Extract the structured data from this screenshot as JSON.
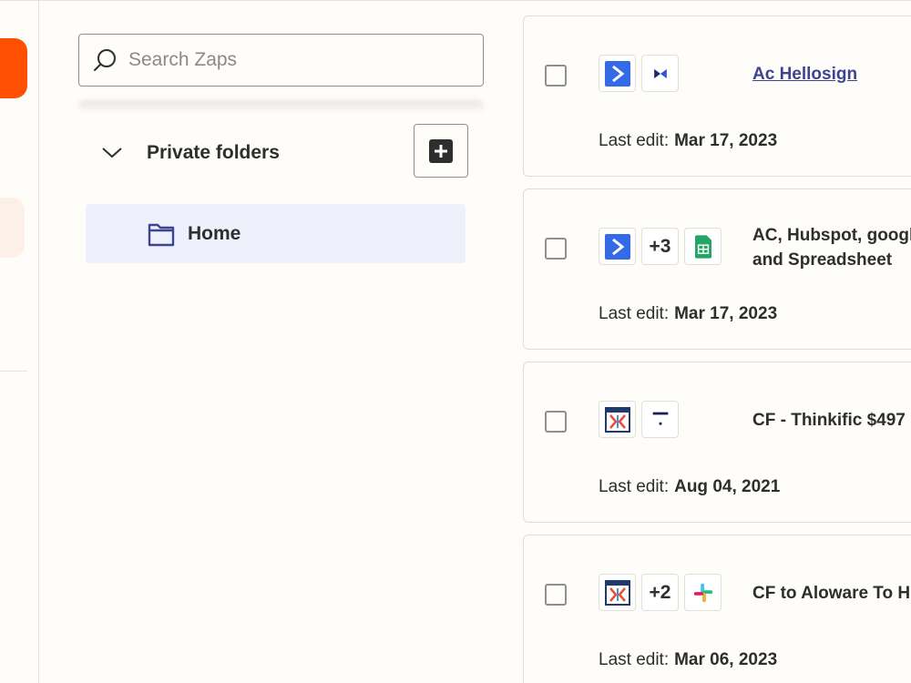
{
  "search": {
    "placeholder": "Search Zaps"
  },
  "folders": {
    "header": "Private folders",
    "items": [
      {
        "label": "Home"
      }
    ]
  },
  "zaps": [
    {
      "title": "Ac Hellosign",
      "title_is_link": true,
      "apps": [
        "activecampaign-icon",
        "hellosign-icon"
      ],
      "last_edit_label": "Last edit:",
      "last_edit_date": "Mar 17, 2023"
    },
    {
      "title_line1": "AC, Hubspot, googl",
      "title_line2": "and Spreadsheet",
      "apps": [
        "activecampaign-icon",
        "+3",
        "google-sheets-icon"
      ],
      "extra_apps": "+3",
      "last_edit_label": "Last edit:",
      "last_edit_date": "Mar 17, 2023"
    },
    {
      "title": "CF - Thinkific $497",
      "apps": [
        "clickfunnels-icon",
        "thinkific-icon"
      ],
      "last_edit_label": "Last edit:",
      "last_edit_date": "Aug 04, 2021"
    },
    {
      "title": "CF to Aloware To Hu",
      "apps": [
        "clickfunnels-icon",
        "+2",
        "slack-icon"
      ],
      "extra_apps": "+2",
      "last_edit_label": "Last edit:",
      "last_edit_date": "Mar 06, 2023"
    }
  ],
  "colors": {
    "brand_orange": "#ff4f00",
    "link": "#3d4592",
    "selected_folder_bg": "#eef0fb",
    "activecampaign_blue": "#356ae6",
    "sheets_green": "#23a566"
  }
}
